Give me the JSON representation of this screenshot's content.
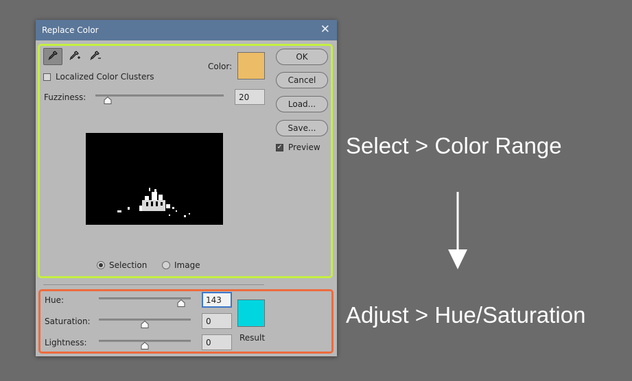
{
  "dialog": {
    "title": "Replace Color",
    "close_icon": "close-icon"
  },
  "selection": {
    "tools": [
      "eyedropper-icon",
      "eyedropper-plus-icon",
      "eyedropper-minus-icon"
    ],
    "localized_label": "Localized Color Clusters",
    "localized_checked": false,
    "color_label": "Color:",
    "color_swatch": "#ecbc66",
    "fuzziness_label": "Fuzziness:",
    "fuzziness_value": "20",
    "radio_selection": "Selection",
    "radio_image": "Image",
    "selected_view": "Selection"
  },
  "buttons": {
    "ok": "OK",
    "cancel": "Cancel",
    "load": "Load...",
    "save": "Save...",
    "preview_label": "Preview",
    "preview_checked": true
  },
  "adjust": {
    "hue_label": "Hue:",
    "hue_value": "143",
    "saturation_label": "Saturation:",
    "saturation_value": "0",
    "lightness_label": "Lightness:",
    "lightness_value": "0",
    "result_label": "Result",
    "result_swatch": "#00d6e0"
  },
  "annotations": {
    "top": "Select > Color Range",
    "bottom": "Adjust > Hue/Saturation",
    "arrow_icon": "arrow-down-icon"
  },
  "colors": {
    "green_highlight": "#c4f03e",
    "orange_highlight": "#ee6b3c",
    "titlebar": "#5a7698"
  }
}
